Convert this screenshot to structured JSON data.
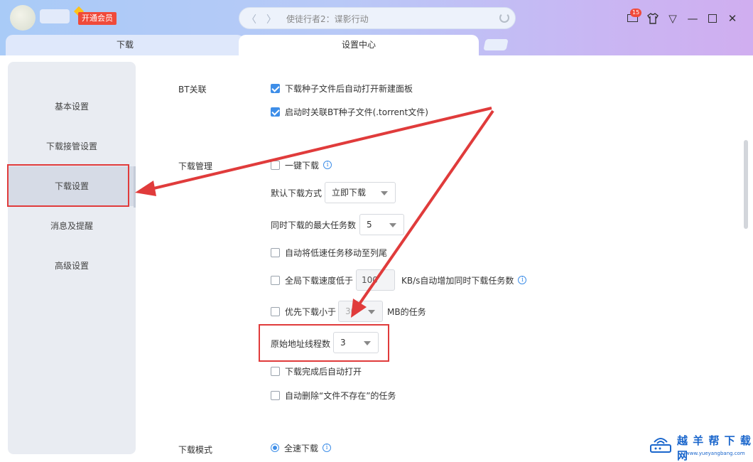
{
  "header": {
    "vip_label": "开通会员",
    "address_text": "使徒行者2：谍影行动",
    "nav_back": "〈",
    "nav_fwd": "〉",
    "mail_count": "15",
    "win_min": "—",
    "win_close": "✕",
    "win_menu": "▽"
  },
  "tabs": [
    {
      "label": "下载"
    },
    {
      "label": "设置中心"
    }
  ],
  "sidebar": {
    "items": [
      {
        "label": "基本设置"
      },
      {
        "label": "下载接管设置"
      },
      {
        "label": "下载设置",
        "active": true
      },
      {
        "label": "消息及提醒"
      },
      {
        "label": "高级设置"
      }
    ]
  },
  "settings": {
    "bt": {
      "label": "BT关联",
      "auto_open_new_panel": {
        "label": "下载种子文件后自动打开新建面板",
        "checked": true
      },
      "associate_torrent": {
        "label": "启动时关联BT种子文件(.torrent文件)",
        "checked": true
      }
    },
    "manage": {
      "label": "下载管理",
      "one_click": {
        "label": "一键下载",
        "checked": false
      },
      "default_mode": {
        "label": "默认下载方式",
        "value": "立即下载"
      },
      "max_tasks": {
        "label": "同时下载的最大任务数",
        "value": "5"
      },
      "move_slow_tasks": {
        "label": "自动将低速任务移动至列尾",
        "checked": false
      },
      "global_speed": {
        "label": "全局下载速度低于",
        "value": "100",
        "suffix": "KB/s自动增加同时下载任务数",
        "checked": false
      },
      "priority_small": {
        "label": "优先下载小于",
        "value": "30",
        "suffix": "MB的任务",
        "checked": false
      },
      "origin_threads": {
        "label": "原始地址线程数",
        "value": "3"
      },
      "auto_open_done": {
        "label": "下载完成后自动打开",
        "checked": false
      },
      "auto_delete_missing": {
        "label": "自动删除“文件不存在”的任务",
        "checked": false
      }
    },
    "mode": {
      "label": "下载模式",
      "full_speed": {
        "label": "全速下载",
        "selected": true
      }
    }
  },
  "watermark": {
    "title": "越 羊 帮 下 载 网",
    "url": "www.yueyangbang.com"
  },
  "colors": {
    "accent": "#3e8ee8",
    "highlight_red": "#e03b3b",
    "vip_red": "#f04a3a"
  }
}
